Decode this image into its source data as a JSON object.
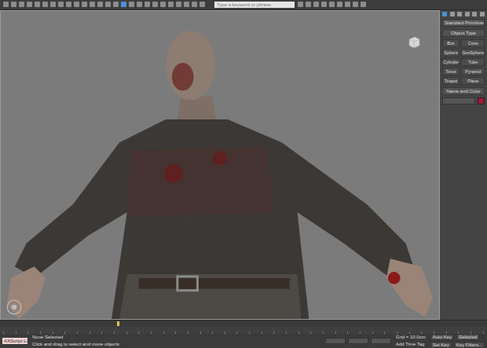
{
  "toolbar": {
    "search": {
      "placeholder": "Type a keyword or phrase"
    }
  },
  "command_panel": {
    "dropdown": "Standard Primitives",
    "object_type": "Object Type",
    "buttons": [
      {
        "label": "Box",
        "selected": false
      },
      {
        "label": "Cone",
        "selected": false
      },
      {
        "label": "Sphere",
        "selected": false
      },
      {
        "label": "GeoSphere",
        "selected": false
      },
      {
        "label": "Cylinder",
        "selected": false
      },
      {
        "label": "Tube",
        "selected": false
      },
      {
        "label": "Torus",
        "selected": false
      },
      {
        "label": "Pyramid",
        "selected": false
      },
      {
        "label": "Teapot",
        "selected": false
      },
      {
        "label": "Plane",
        "selected": false
      }
    ],
    "name_and_color": "Name and Color",
    "object_color": "#9b1b30"
  },
  "timeline": {
    "level": 0.24
  },
  "status_bar": {
    "maxscript": "AXScript Li.",
    "selection": "None Selected",
    "prompt": "Click and drag to select and move objects",
    "grid": "Grid = 10.0cm",
    "add_time_tag": "Add Time Tag",
    "auto_key": "Auto Key",
    "key_mode": "Selected",
    "set_key": "Set Key",
    "key_filters": "Key Filters..."
  }
}
